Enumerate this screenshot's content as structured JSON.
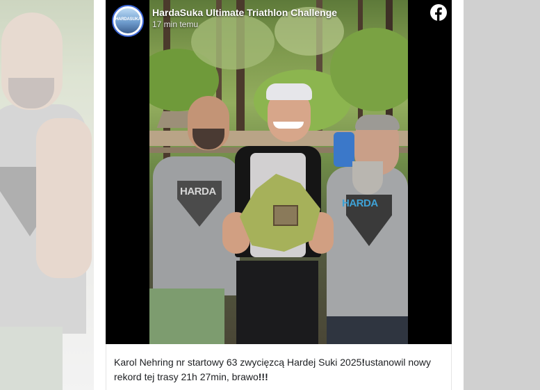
{
  "post": {
    "page_name": "HardaSuka Ultimate Triathlon Challenge",
    "time_ago": "17 min temu",
    "avatar_text": "HARDASUKA",
    "caption_main": "Karol Nehring nr startowy 63 zwycięzcą Hardej Suki 2025",
    "caption_bold_1": "!",
    "caption_mid": "ustanowil nowy rekord tej trasy 21h 27min, brawo",
    "caption_bold_2": "!!!"
  },
  "photo": {
    "hoodie_left_print": "HARDA",
    "hoodie_right_print": "HARDA"
  },
  "icons": {
    "platform": "facebook-icon"
  },
  "colors": {
    "avatar_ring": "#3b66d6",
    "caption_text": "#1c1e21",
    "page_bg": "#d0d0d0"
  }
}
